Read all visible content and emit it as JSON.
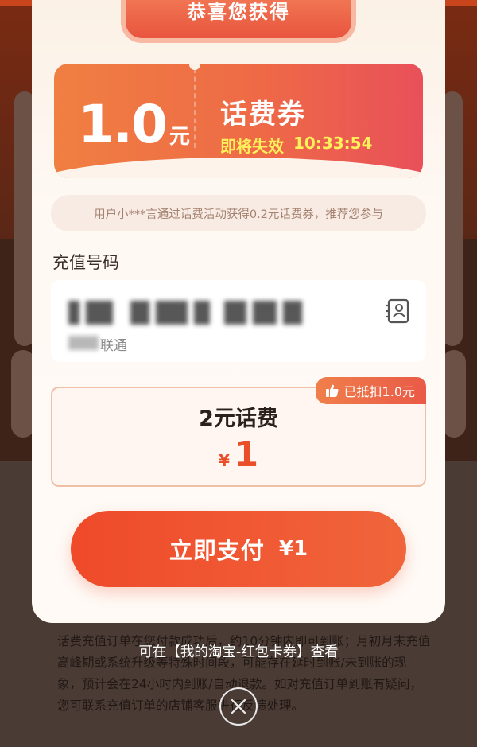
{
  "modal": {
    "banner_title": "恭喜您获得"
  },
  "coupon": {
    "amount": "1.0",
    "amount_unit": "元",
    "title": "话费券",
    "expire_label": "即将失效",
    "countdown": "10:33:54"
  },
  "notice": {
    "text": "用户小***言通过话费活动获得0.2元话费券，推荐您参与"
  },
  "recharge": {
    "label": "充值号码",
    "phone_number": "",
    "carrier": "联通",
    "contact_icon": "contact-book-icon"
  },
  "product": {
    "deduct_badge": "已抵扣1.0元",
    "deduct_icon": "thumbs-up-icon",
    "name": "2元话费",
    "currency": "¥",
    "price": "1"
  },
  "pay": {
    "label": "立即支付",
    "price": "¥1"
  },
  "tip": {
    "text": "可在【我的淘宝-红包卡券】查看"
  },
  "background": {
    "note": "话费充值订单在您付款成功后，约10分钟内即可到账；月初月末充值高峰期或系统升级等特殊时间段，可能存在延时到账/未到账的现象，预计会在24小时内到账/自动退款。如对充值订单到账有疑问，您可联系充值订单的店铺客服进行反馈处理。"
  },
  "colors": {
    "accent": "#ef4a2a",
    "coupon_start": "#f07f42",
    "coupon_end": "#e9505a",
    "expire_text": "#fff15a"
  }
}
